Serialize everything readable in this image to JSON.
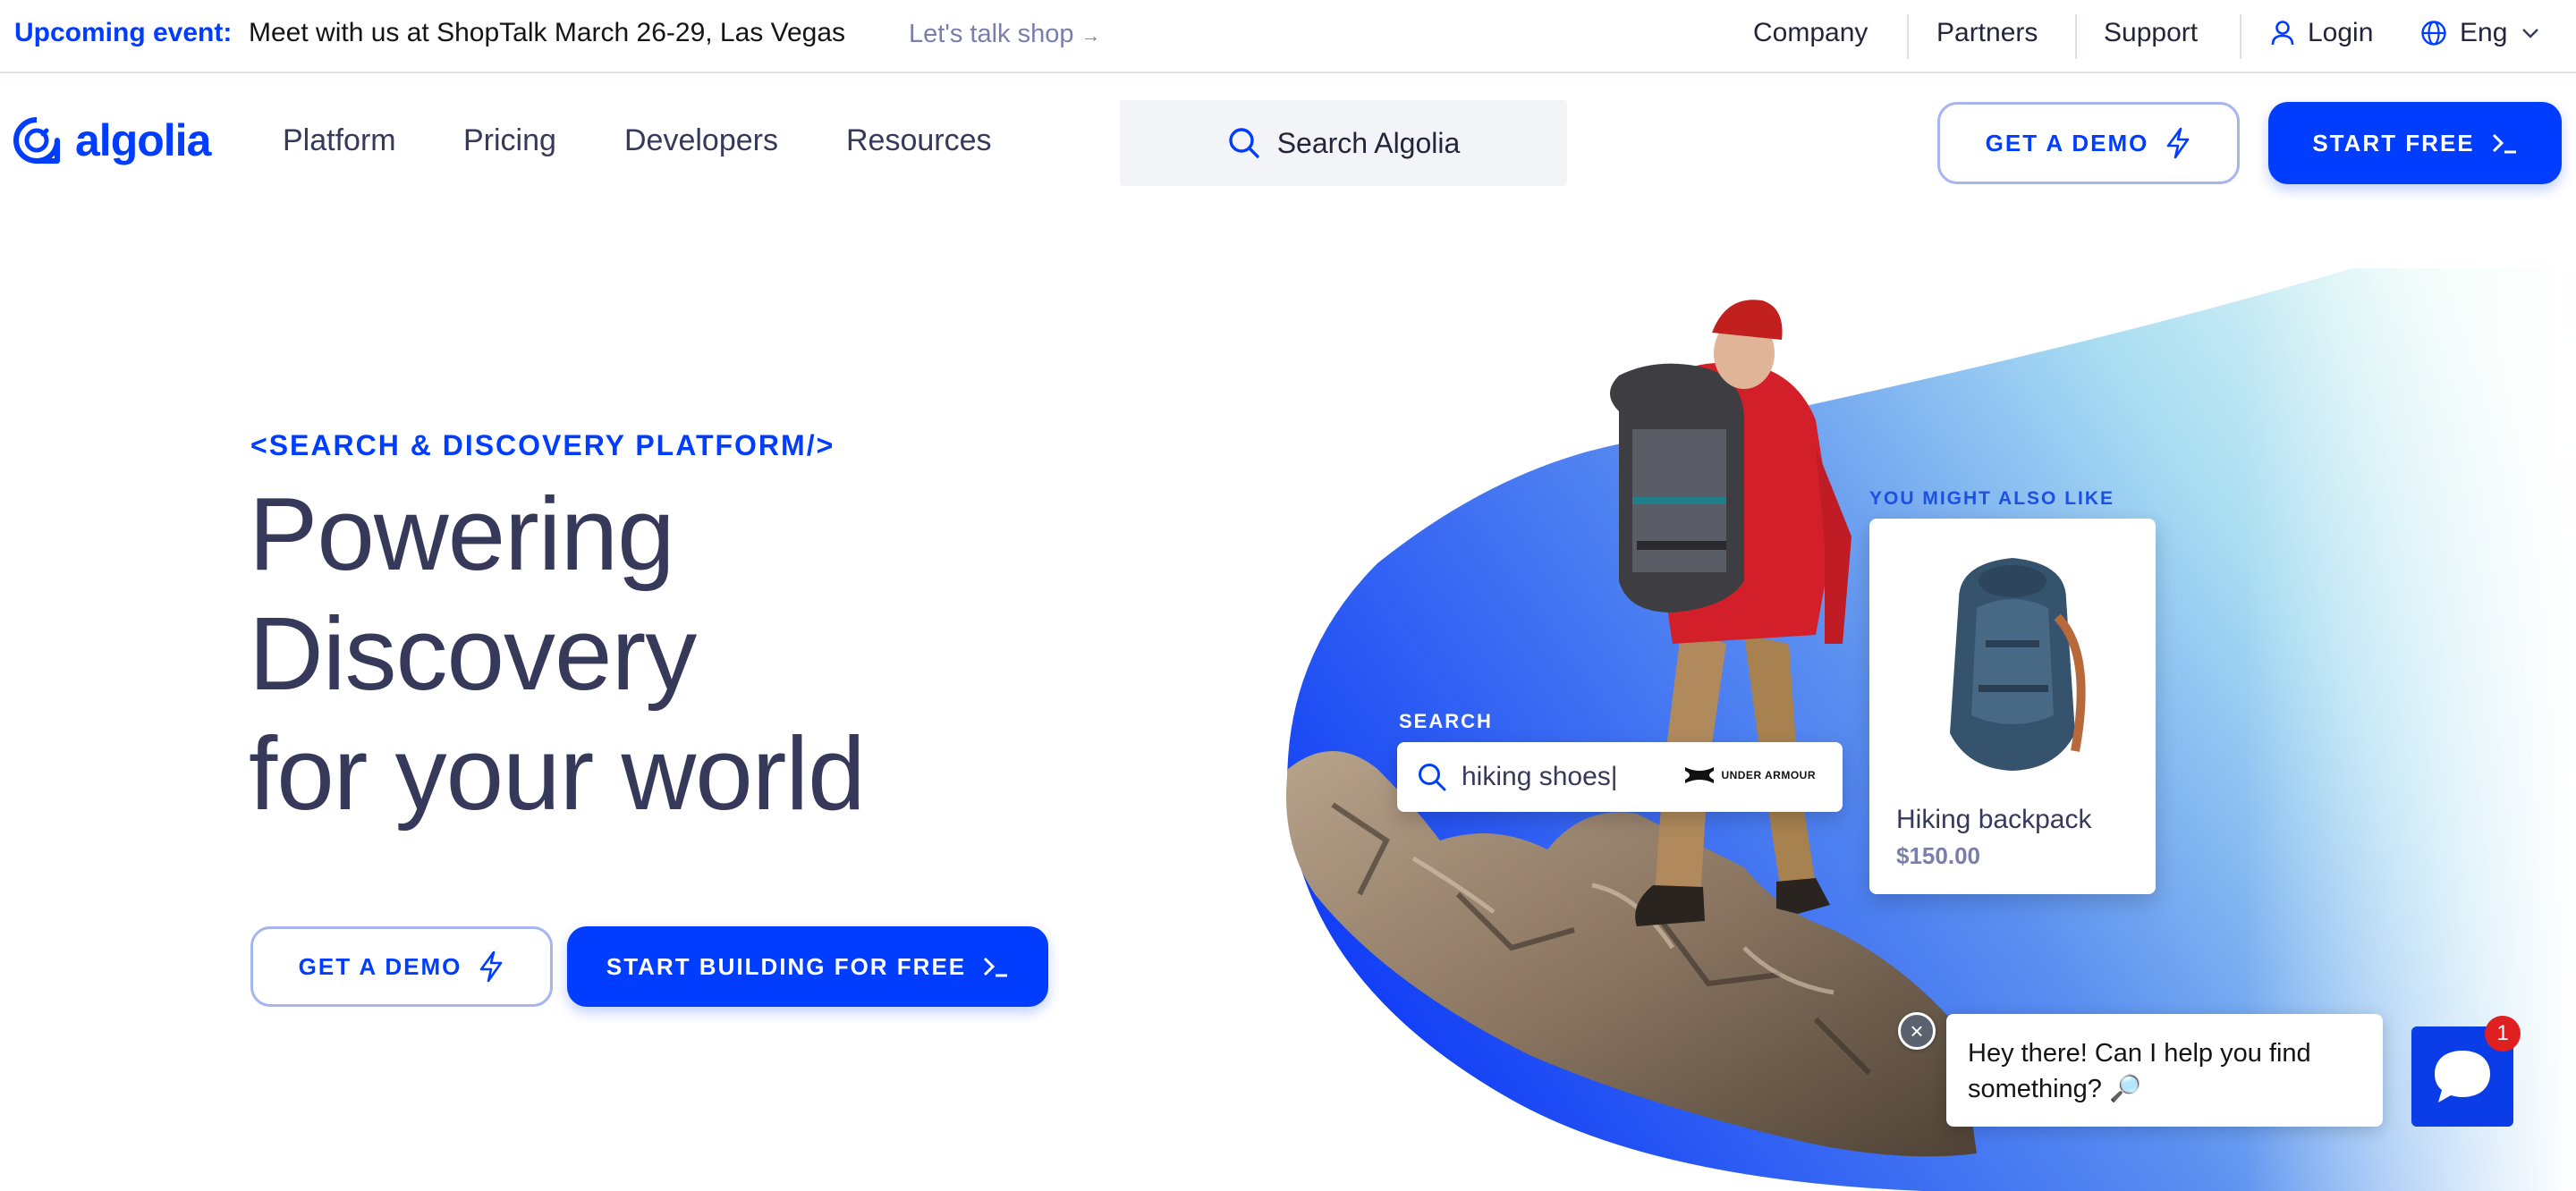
{
  "announcement": {
    "label": "Upcoming event:",
    "text": "Meet with us at ShopTalk March 26-29, Las Vegas",
    "link": "Let's talk shop"
  },
  "utility_nav": {
    "company": "Company",
    "partners": "Partners",
    "support": "Support",
    "login": "Login",
    "language": "Eng"
  },
  "nav": {
    "logo": "algolia",
    "items": [
      "Platform",
      "Pricing",
      "Developers",
      "Resources"
    ],
    "search_placeholder": "Search Algolia",
    "demo_button": "GET A DEMO",
    "start_button": "START FREE"
  },
  "hero": {
    "eyebrow": "<SEARCH & DISCOVERY PLATFORM/>",
    "headline": [
      "Powering",
      "Discovery",
      "for your world"
    ],
    "demo_button": "GET A DEMO",
    "start_button": "START BUILDING FOR FREE"
  },
  "visual": {
    "search_label": "SEARCH",
    "search_query": "hiking shoes|",
    "brand": "UNDER ARMOUR",
    "recommend_label": "YOU MIGHT ALSO LIKE",
    "product_name": "Hiking backpack",
    "product_price": "$150.00"
  },
  "chat": {
    "message": "Hey there! Can I help you find something? 🔎",
    "badge_count": "1"
  },
  "colors": {
    "brand_blue": "#003dff",
    "text_dark": "#36395a",
    "muted": "#7a7eaa",
    "badge_red": "#e02020"
  }
}
